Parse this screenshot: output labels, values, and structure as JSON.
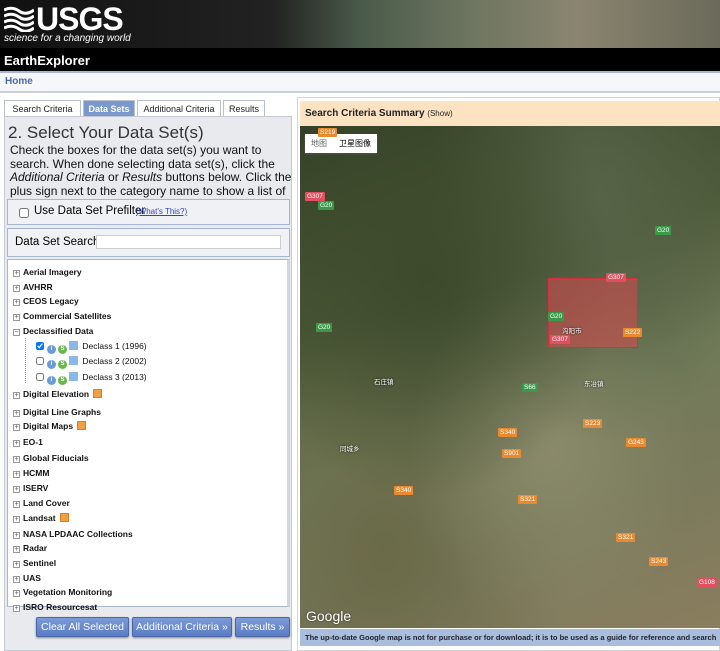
{
  "header": {
    "logo": "USGS",
    "tagline": "science for a changing world",
    "app_title": "EarthExplorer"
  },
  "nav": {
    "home": "Home"
  },
  "tabs": [
    {
      "label": "Search Criteria",
      "active": false
    },
    {
      "label": "Data Sets",
      "active": true
    },
    {
      "label": "Additional Criteria",
      "active": false
    },
    {
      "label": "Results",
      "active": false
    }
  ],
  "datasets": {
    "title": "2. Select Your Data Set(s)",
    "instructions_1": "Check the boxes for the data set(s) you want to search. When done selecting data set(s), click the ",
    "instructions_em1": "Additional Criteria",
    "instructions_2": " or ",
    "instructions_em2": "Results",
    "instructions_3": " buttons below. Click the plus sign next to the category name to show a list of data sets.",
    "prefilter_label": "Use Data Set Prefilter",
    "prefilter_checked": false,
    "whats_this": "(What's This?)",
    "search_label": "Data Set Search:",
    "search_value": "",
    "categories": [
      {
        "label": "Aerial Imagery",
        "expanded": false
      },
      {
        "label": "AVHRR",
        "expanded": false
      },
      {
        "label": "CEOS Legacy",
        "expanded": false
      },
      {
        "label": "Commercial Satellites",
        "expanded": false
      },
      {
        "label": "Declassified Data",
        "expanded": true,
        "children": [
          {
            "label": "Declass 1 (1996)",
            "checked": true
          },
          {
            "label": "Declass 2 (2002)",
            "checked": false
          },
          {
            "label": "Declass 3 (2013)",
            "checked": false
          }
        ]
      },
      {
        "label": "Digital Elevation",
        "expanded": false,
        "flag": true
      },
      {
        "label": "Digital Line Graphs",
        "expanded": false
      },
      {
        "label": "Digital Maps",
        "expanded": false,
        "flag": true
      },
      {
        "label": "EO-1",
        "expanded": false
      },
      {
        "label": "Global Fiducials",
        "expanded": false
      },
      {
        "label": "HCMM",
        "expanded": false
      },
      {
        "label": "ISERV",
        "expanded": false
      },
      {
        "label": "Land Cover",
        "expanded": false
      },
      {
        "label": "Landsat",
        "expanded": false,
        "flag": true
      },
      {
        "label": "NASA LPDAAC Collections",
        "expanded": false
      },
      {
        "label": "Radar",
        "expanded": false
      },
      {
        "label": "Sentinel",
        "expanded": false
      },
      {
        "label": "UAS",
        "expanded": false
      },
      {
        "label": "Vegetation Monitoring",
        "expanded": false
      },
      {
        "label": "ISRO Resourcesat",
        "expanded": false
      }
    ],
    "buttons": {
      "clear": "Clear All Selected",
      "additional": "Additional Criteria »",
      "results": "Results »"
    }
  },
  "summary": {
    "title": "Search Criteria Summary",
    "show": "(Show)"
  },
  "map": {
    "type_map": "地图",
    "type_satellite": "卫星图像",
    "selected_type": "卫星图像",
    "attribution": "Google",
    "aoi_color": "#e64650",
    "labels": [
      "S219",
      "G307",
      "G20",
      "G20",
      "G307",
      "G20",
      "G20",
      "G307",
      "S222",
      "S66",
      "S223",
      "S340",
      "G243",
      "S901",
      "S340",
      "S321",
      "S321",
      "S243",
      "G108",
      "沟阳市",
      "石庄镇",
      "东冶镇",
      "同城乡"
    ],
    "note": "The up-to-date Google map is not for purchase or for download; it is to be used as a guide for reference and search"
  }
}
